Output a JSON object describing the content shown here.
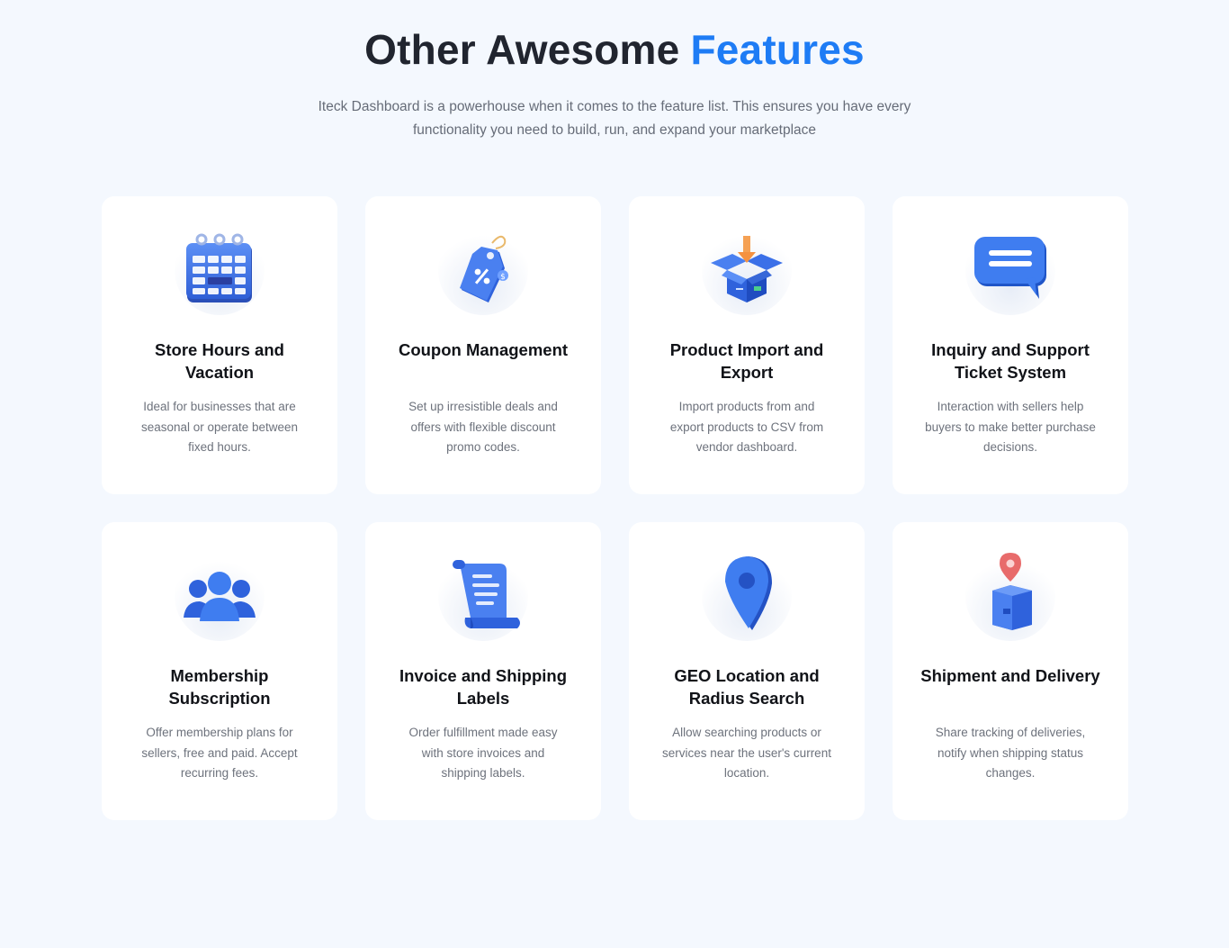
{
  "header": {
    "title_main": "Other Awesome",
    "title_accent": "Features",
    "subtitle": "Iteck Dashboard is a powerhouse when it comes to the feature list. This ensures you have every functionality you need to build, run, and expand your marketplace"
  },
  "colors": {
    "accent": "#1e7cf5",
    "background": "#f4f8fe",
    "card": "#ffffff",
    "heading": "#21252f"
  },
  "features": [
    {
      "icon": "calendar-icon",
      "title": "Store Hours and Vacation",
      "desc": "Ideal for businesses that are seasonal or operate between fixed hours."
    },
    {
      "icon": "discount-tag-icon",
      "title": "Coupon Management",
      "desc": "Set up irresistible deals and offers with flexible discount promo codes."
    },
    {
      "icon": "box-import-icon",
      "title": "Product Import and Export",
      "desc": "Import products from and export products to CSV from vendor dashboard."
    },
    {
      "icon": "chat-bubble-icon",
      "title": "Inquiry and Support Ticket System",
      "desc": "Interaction with sellers help buyers to make better purchase decisions."
    },
    {
      "icon": "users-group-icon",
      "title": "Membership Subscription",
      "desc": "Offer membership plans for sellers, free and paid. Accept recurring fees."
    },
    {
      "icon": "invoice-scroll-icon",
      "title": "Invoice and Shipping Labels",
      "desc": "Order fulfillment made easy with store invoices and shipping labels."
    },
    {
      "icon": "location-pin-icon",
      "title": "GEO Location and Radius Search",
      "desc": "Allow searching products or services near the user's current location."
    },
    {
      "icon": "delivery-box-pin-icon",
      "title": "Shipment and Delivery",
      "desc": "Share tracking of deliveries, notify when shipping status changes."
    }
  ]
}
